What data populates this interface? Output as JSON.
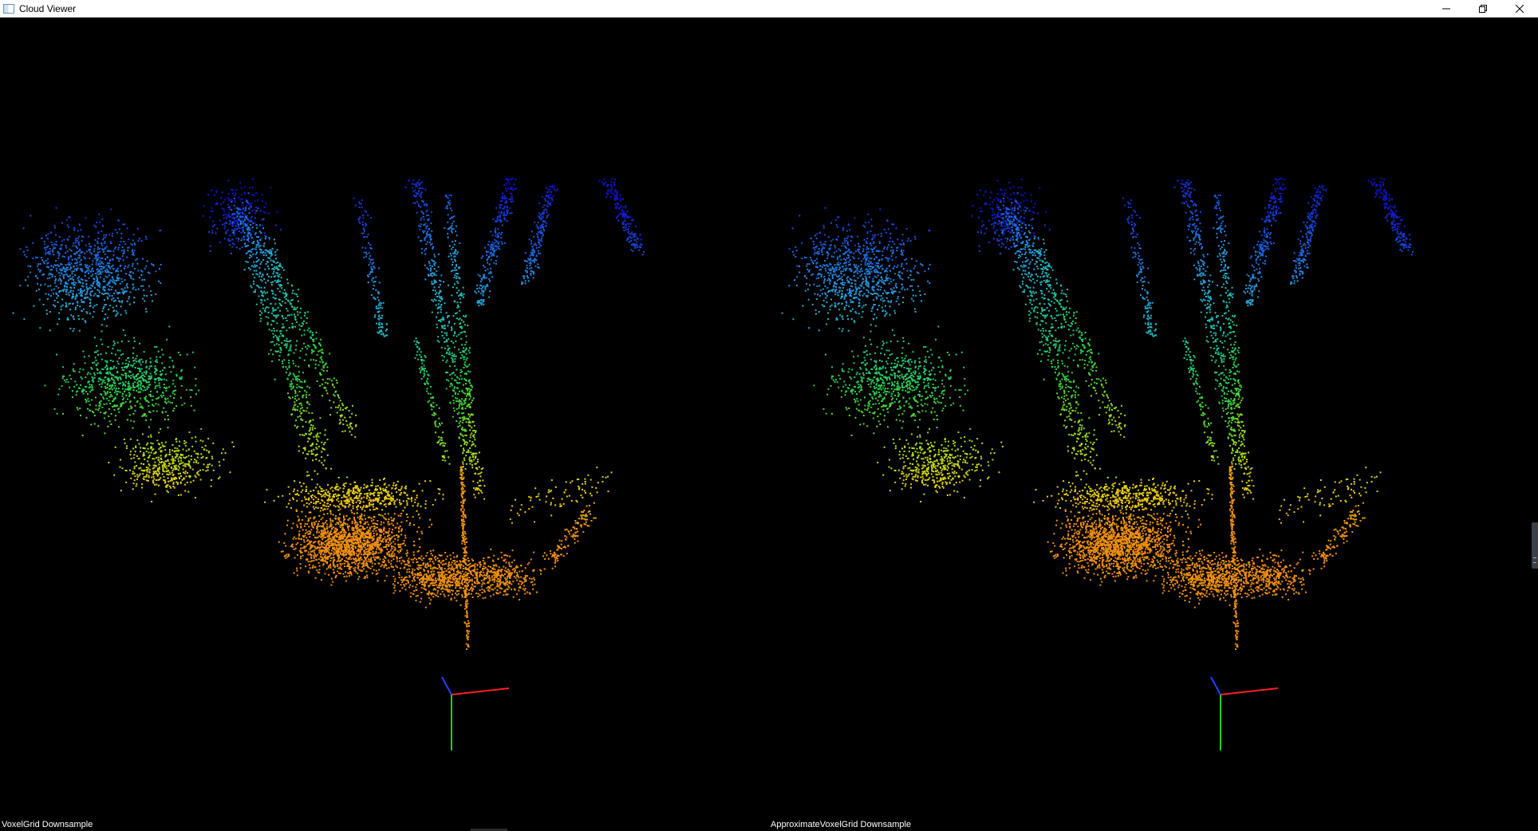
{
  "window": {
    "title": "Cloud Viewer",
    "icon": "window-app-icon",
    "controls": {
      "minimize": "minimize-icon",
      "restore": "restore-icon",
      "close": "close-icon"
    }
  },
  "viewports": [
    {
      "label": "VoxelGrid Downsample"
    },
    {
      "label": "ApproximateVoxelGrid Downsample"
    }
  ],
  "axes_colors": {
    "x": "#ff2020",
    "y": "#20d020",
    "z": "#2040ff"
  },
  "colormap": [
    "#1010c8",
    "#1a5ae0",
    "#28a8e0",
    "#20c8a0",
    "#30d040",
    "#a8e020",
    "#f0d010",
    "#f09010"
  ]
}
